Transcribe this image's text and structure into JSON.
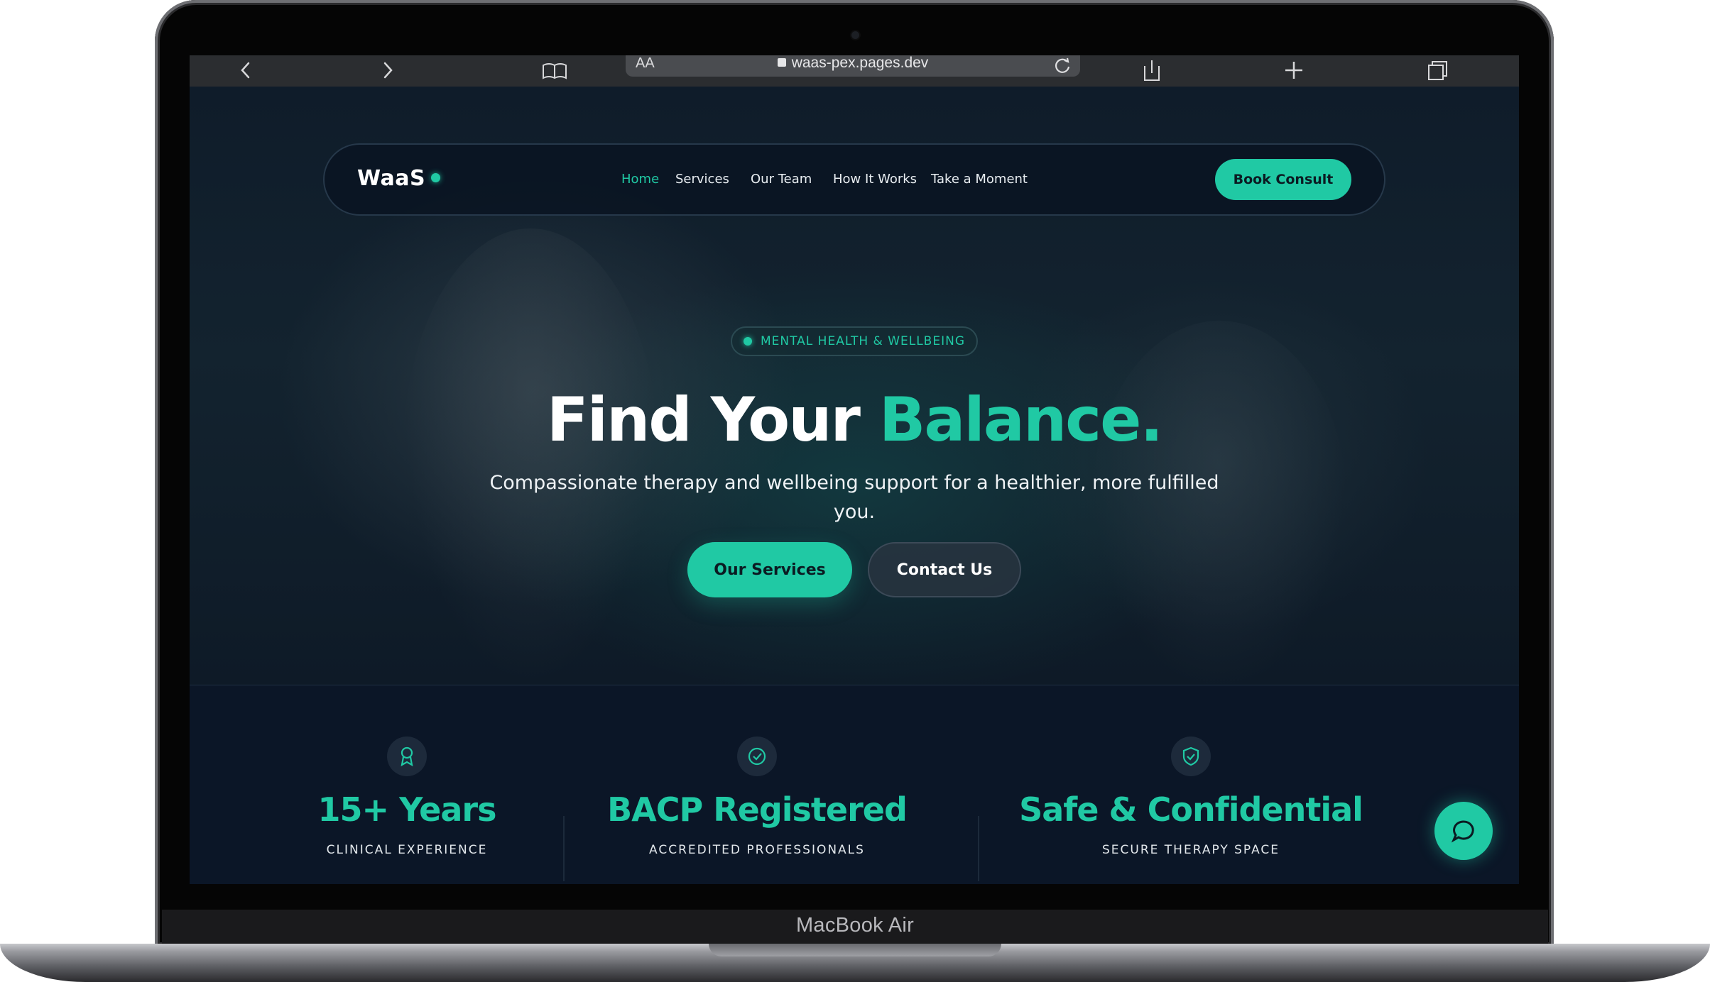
{
  "device": {
    "label": "MacBook Air"
  },
  "browser": {
    "text_size": "AA",
    "url": "waas-pex.pages.dev",
    "icons": [
      "chevron-left-icon",
      "chevron-right-icon",
      "book-icon",
      "lock-icon",
      "reload-icon",
      "share-icon",
      "plus-icon",
      "tabs-icon"
    ]
  },
  "nav": {
    "brand": "WaaS",
    "links": [
      {
        "label": "Home",
        "active": true
      },
      {
        "label": "Services",
        "active": false
      },
      {
        "label": "Our Team",
        "active": false
      },
      {
        "label": "How It Works",
        "active": false
      },
      {
        "label": "Take a Moment",
        "active": false
      }
    ],
    "cta": "Book Consult"
  },
  "hero": {
    "badge": "MENTAL HEALTH & WELLBEING",
    "title_main": "Find Your ",
    "title_accent": "Balance.",
    "subtitle": "Compassionate therapy and wellbeing support for a healthier, more fulfilled you.",
    "primary_button": "Our Services",
    "secondary_button": "Contact Us"
  },
  "stats": [
    {
      "icon": "award-icon",
      "value": "15+ Years",
      "label": "CLINICAL EXPERIENCE"
    },
    {
      "icon": "check-badge-icon",
      "value": "BACP Registered",
      "label": "ACCREDITED PROFESSIONALS"
    },
    {
      "icon": "shield-check-icon",
      "value": "Safe & Confidential",
      "label": "SECURE THERAPY SPACE"
    }
  ],
  "chat": {
    "icon": "chat-bubble-icon"
  },
  "colors": {
    "accent": "#20c9a4",
    "background": "#0b1627",
    "text": "#ffffff"
  }
}
